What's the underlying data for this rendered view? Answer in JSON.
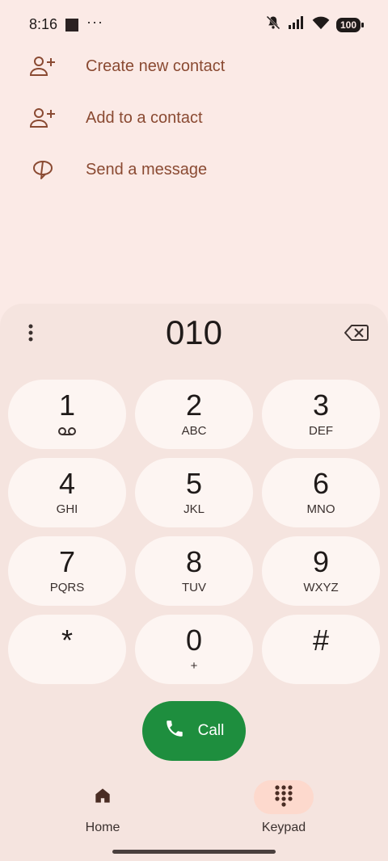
{
  "status": {
    "time": "8:16",
    "more": "···",
    "battery": "100"
  },
  "actions": [
    {
      "label": "Create new contact",
      "icon": "person-add-icon"
    },
    {
      "label": "Add to a contact",
      "icon": "person-add-icon"
    },
    {
      "label": "Send a message",
      "icon": "message-icon"
    }
  ],
  "dialer": {
    "number": "010",
    "keys": [
      {
        "digit": "1",
        "letters": ""
      },
      {
        "digit": "2",
        "letters": "ABC"
      },
      {
        "digit": "3",
        "letters": "DEF"
      },
      {
        "digit": "4",
        "letters": "GHI"
      },
      {
        "digit": "5",
        "letters": "JKL"
      },
      {
        "digit": "6",
        "letters": "MNO"
      },
      {
        "digit": "7",
        "letters": "PQRS"
      },
      {
        "digit": "8",
        "letters": "TUV"
      },
      {
        "digit": "9",
        "letters": "WXYZ"
      },
      {
        "digit": "*",
        "letters": ""
      },
      {
        "digit": "0",
        "letters": "+"
      },
      {
        "digit": "#",
        "letters": ""
      }
    ],
    "call_label": "Call"
  },
  "nav": {
    "home": "Home",
    "keypad": "Keypad"
  },
  "colors": {
    "background": "#fbeae6",
    "accent": "#8a4a32",
    "call": "#1e8e3e",
    "keypad_active": "#fdd9cd"
  }
}
